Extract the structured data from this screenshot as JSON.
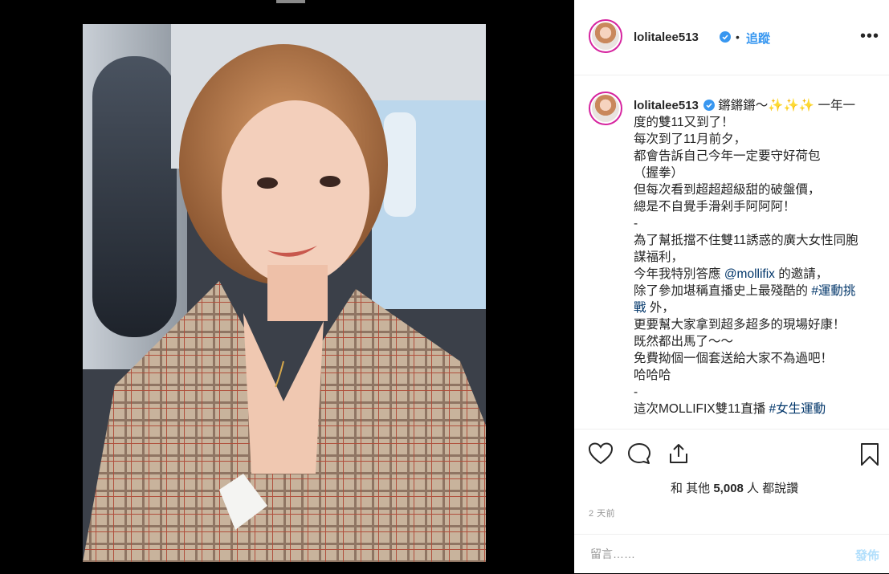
{
  "post": {
    "author": "lolitalee513",
    "follow_label": "追蹤",
    "more_label": "•••",
    "separator": "•",
    "caption_lines": [
      "一年一度的雙11又到了！",
      "每次到了11月前夕，",
      "都會告訴自己今年一定要守好荷包",
      "（握拳）",
      "但每次看到超超超級甜的破盤價，",
      "總是不自覺手滑剁手阿阿阿！",
      "-",
      "為了幫抵擋不住雙11誘惑的廣大女性同胞謀福利，"
    ],
    "caption_intro": "鏘鏘鏘～",
    "sparkles": "✨✨✨",
    "caption_invite_prefix": "今年我特別答應 ",
    "mention": "@mollifix",
    "caption_invite_suffix": " 的邀請，",
    "caption_event_prefix": "除了參加堪稱直播史上最殘酷的 ",
    "hashtag_sports": "#運動挑戰",
    "caption_event_suffix": " 外，",
    "caption_tail_lines": [
      "更要幫大家拿到超多超多的現場好康！",
      "既然都出馬了～～",
      "免費拗個一個套送給大家不為過吧！",
      "哈哈哈",
      "-"
    ],
    "caption_last_prefix": "這次MOLLIFIX雙11直播 ",
    "hashtag_women": "#女生運動",
    "likes_prefix": "和 其他 ",
    "likes_count": "5,008",
    "likes_suffix": " 人 都說讚",
    "timestamp": "2 天前",
    "comment_placeholder": "留言……",
    "post_label": "發佈"
  },
  "icons": {
    "like": "heart-icon",
    "comment": "comment-icon",
    "share": "share-icon",
    "save": "bookmark-icon",
    "verified": "verified-badge-icon"
  },
  "colors": {
    "link": "#003569",
    "follow": "#3897f0",
    "verified": "#3897f0",
    "post_disabled": "#b2dffc"
  }
}
